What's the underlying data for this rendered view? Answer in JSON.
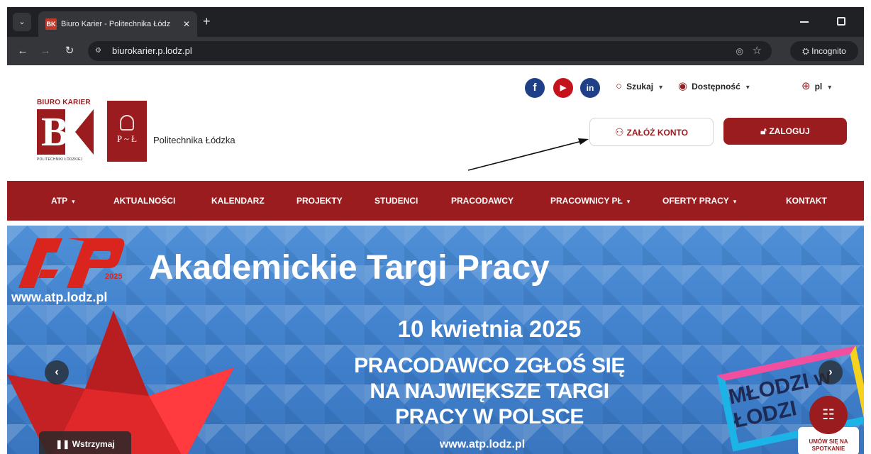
{
  "browser": {
    "tab_title": "Biuro Karier - Politechnika Łódz",
    "tab_favicon": "BK",
    "new_tab_symbol": "+",
    "url": "biurokarier.p.lodz.pl",
    "incognito_label": "Incognito"
  },
  "header": {
    "logo_top": "BIURO KARIER",
    "logo_bottom": "POLITECHNIKI ŁÓDZKIEJ",
    "university_logo_text": "P ~ Ł",
    "university_name": "Politechnika Łódzka",
    "social": [
      "f",
      "▶",
      "in"
    ],
    "search_label": "Szukaj",
    "accessibility_label": "Dostępność",
    "language_label": "pl",
    "account_button": "ZAŁÓŻ KONTO",
    "login_button": "ZALOGUJ"
  },
  "nav": {
    "items": [
      "ATP",
      "AKTUALNOŚCI",
      "KALENDARZ",
      "PROJEKTY",
      "STUDENCI",
      "PRACODAWCY",
      "PRACOWNICY PŁ",
      "OFERTY PRACY",
      "KONTAKT"
    ],
    "has_dropdown": [
      true,
      false,
      false,
      false,
      false,
      false,
      true,
      true,
      false
    ]
  },
  "hero": {
    "atp_year": "2025",
    "atp_url": "www.atp.lodz.pl",
    "title": "Akademickie Targi Pracy",
    "date": "10 kwietnia 2025",
    "lines": [
      "PRACODAWCO ZGŁOŚ SIĘ",
      "NA NAJWIĘKSZE TARGI",
      "PRACY W POLSCE"
    ],
    "url": "www.atp.lodz.pl",
    "campaign_text": "MŁODZI w ŁODZI",
    "pause_label": "Wstrzymaj",
    "meet_label": "UMÓW SIĘ NA SPOTKANIE"
  },
  "colors": {
    "brand": "#9b1c1f",
    "hero_blue": "#4f8fd6",
    "atp_red": "#d9251d"
  }
}
